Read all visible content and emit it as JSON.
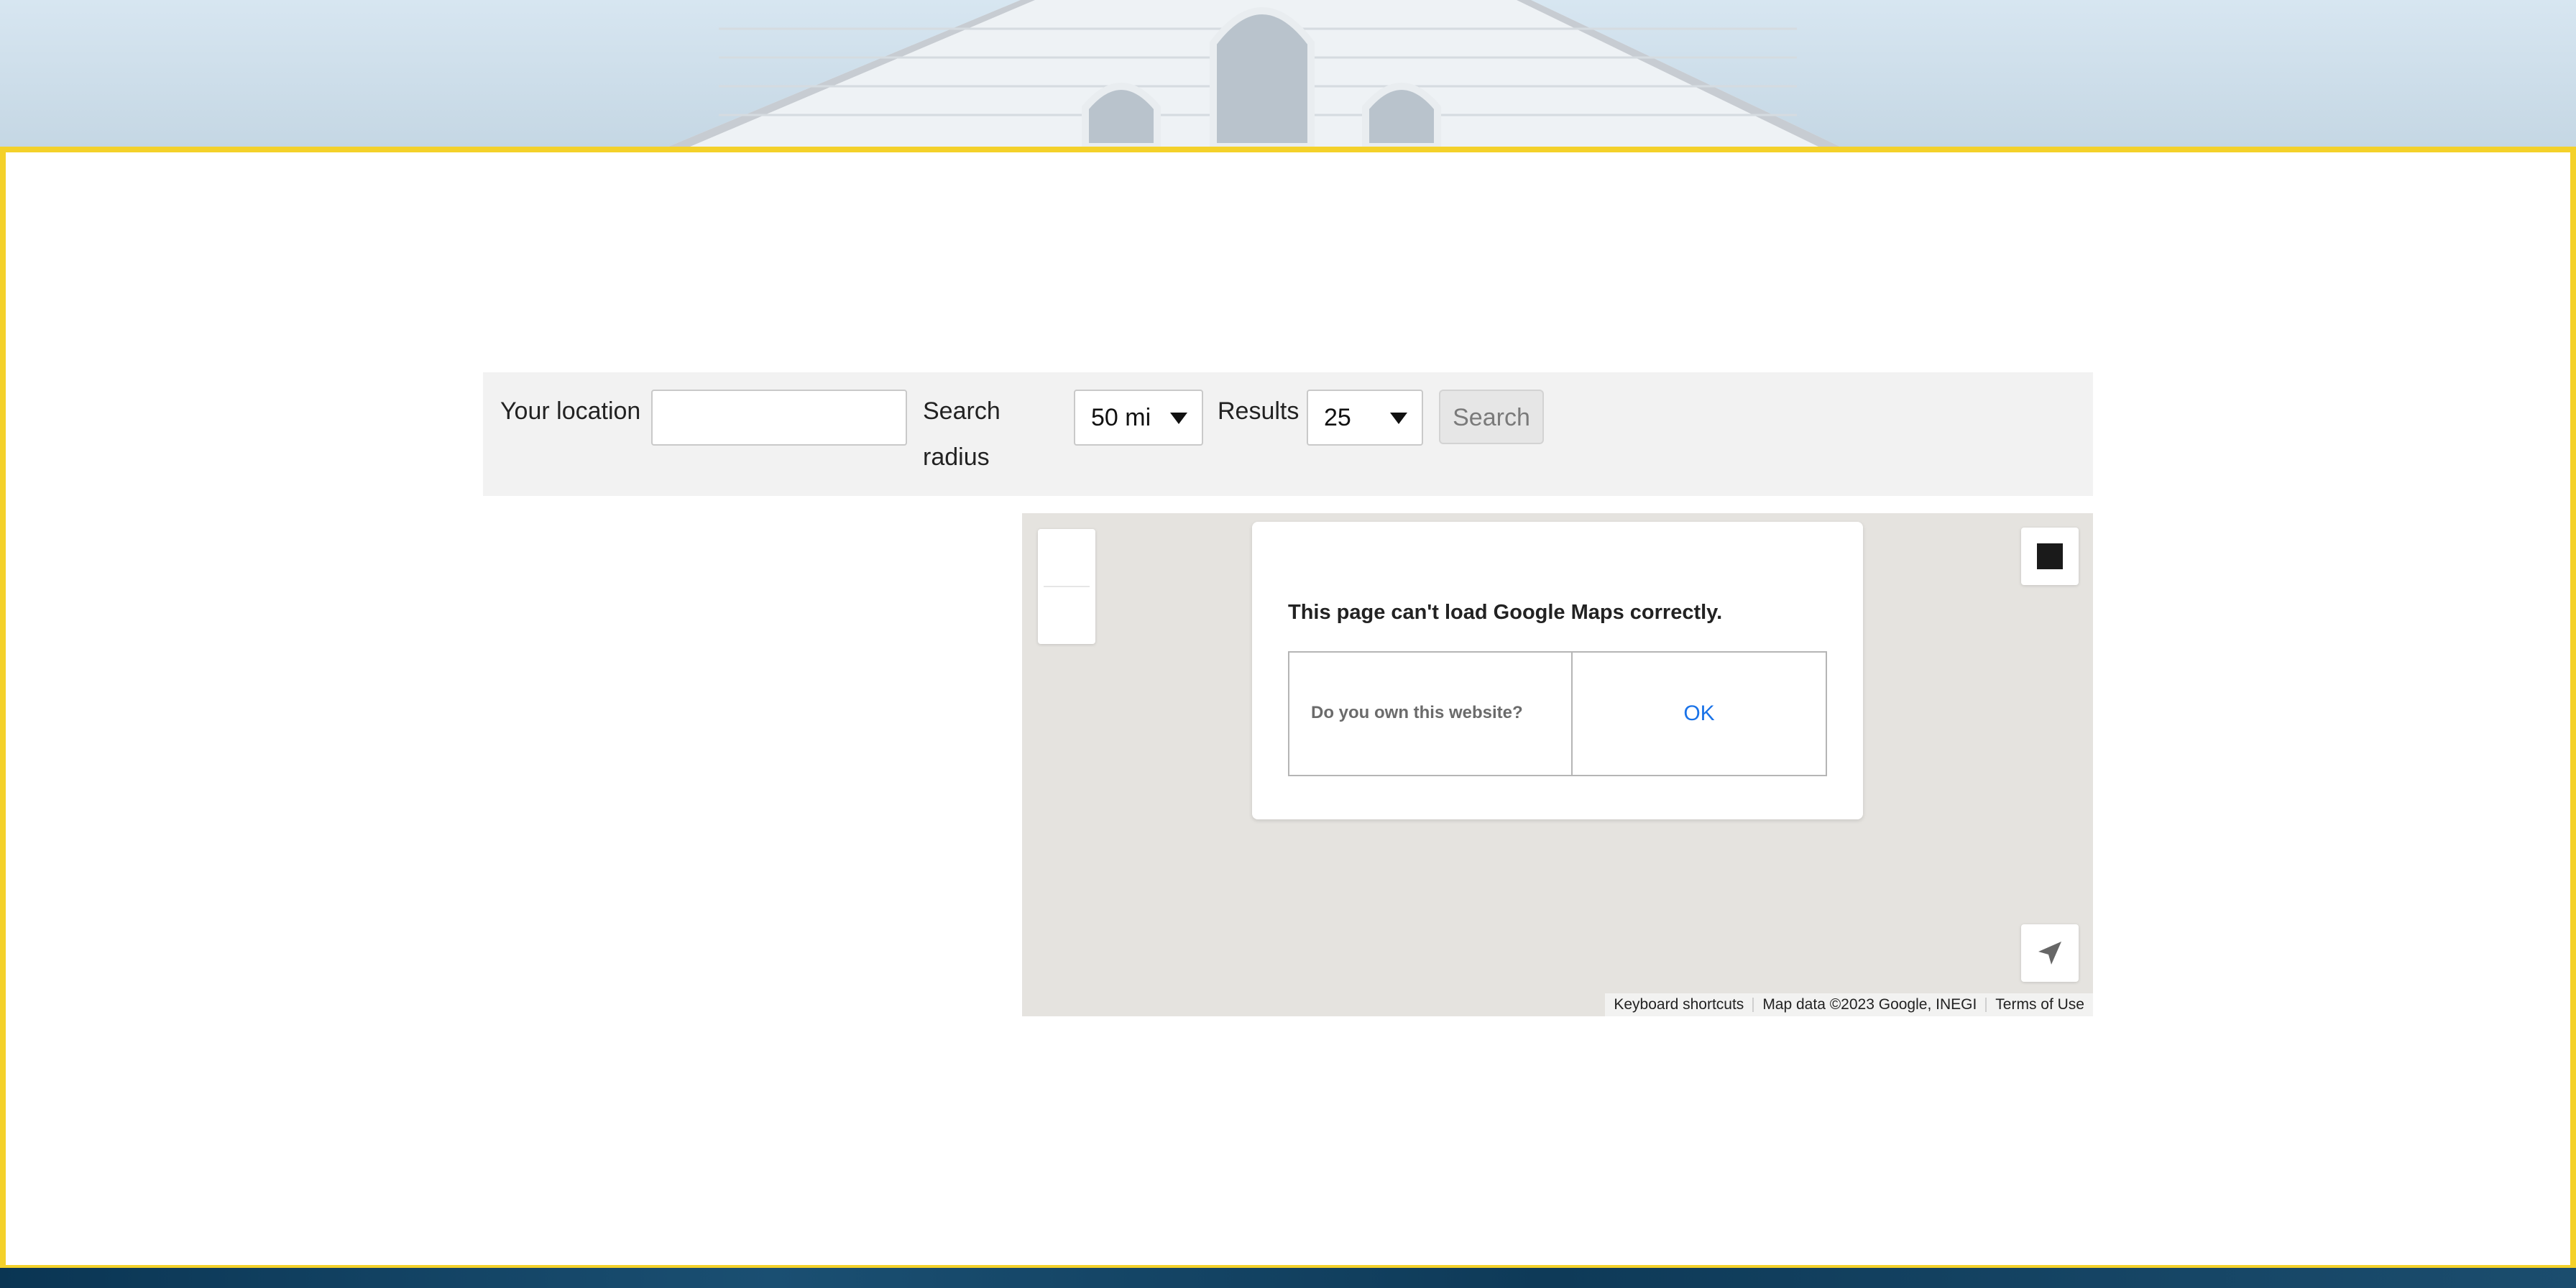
{
  "search": {
    "location_label": "Your location",
    "location_value": "",
    "radius_label": "Search radius",
    "radius_value": "50 mi",
    "results_label": "Results",
    "results_value": "25",
    "search_button": "Search"
  },
  "map": {
    "error_message": "This page can't load Google Maps correctly.",
    "own_website_link": "Do you own this website?",
    "ok_button": "OK",
    "attribution": {
      "keyboard_shortcuts": "Keyboard shortcuts",
      "map_data": "Map data ©2023 Google, INEGI",
      "terms": "Terms of Use"
    },
    "icons": {
      "fullscreen": "fullscreen-icon",
      "locate": "locate-arrow-icon"
    }
  },
  "colors": {
    "panel_border": "#f4d12a",
    "search_bar_bg": "#f2f2f2",
    "map_bg": "#e5e3df",
    "ok_link": "#1a73e8"
  }
}
